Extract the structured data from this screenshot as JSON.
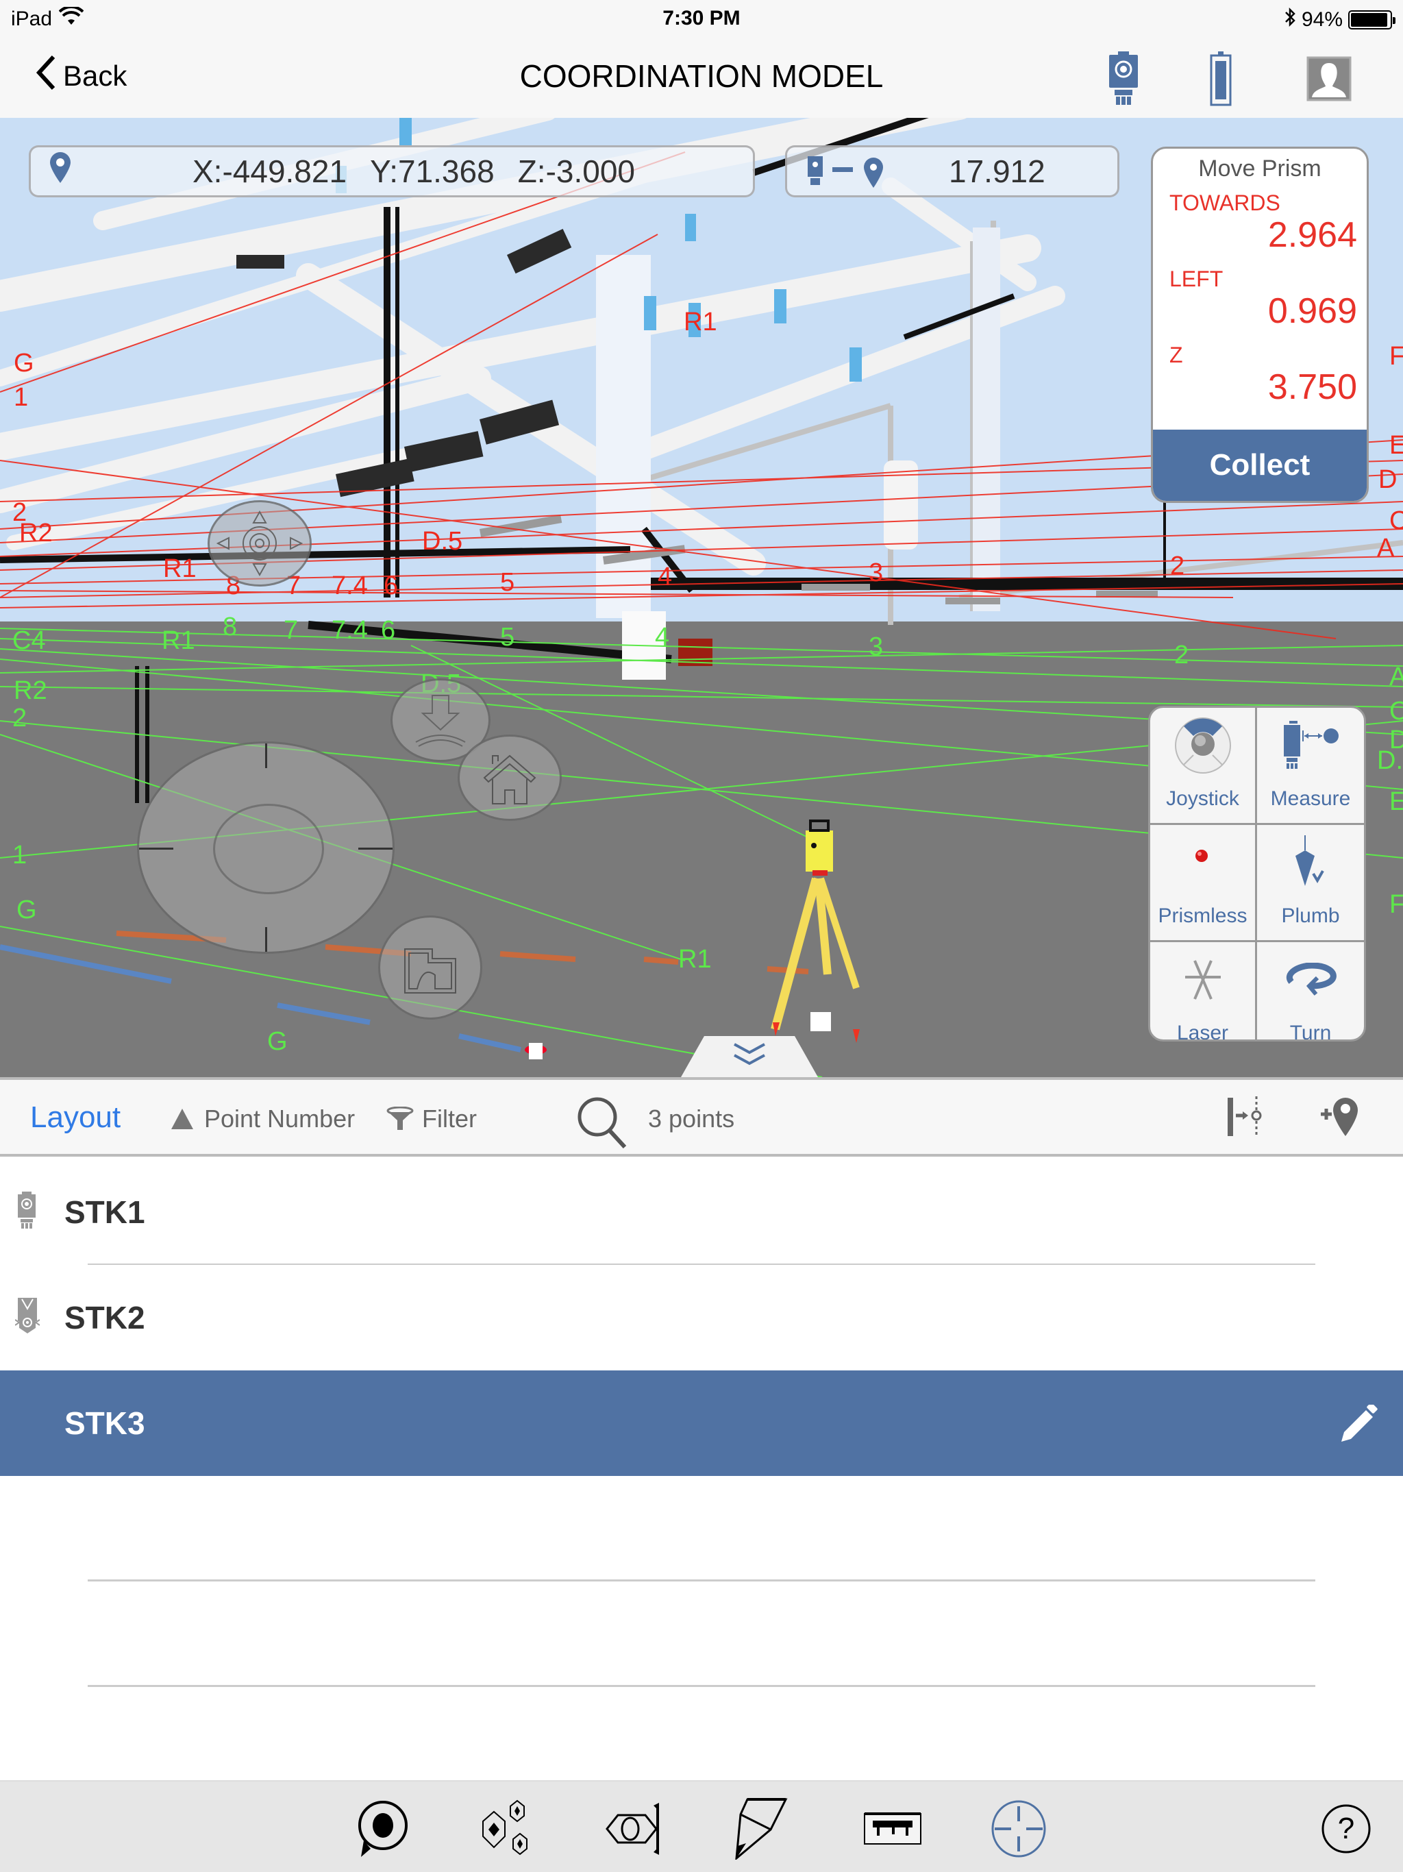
{
  "status_bar": {
    "device": "iPad",
    "time": "7:30 PM",
    "battery_percent": "94%",
    "battery_level": 0.94,
    "icons": [
      "wifi-icon",
      "bluetooth-icon",
      "battery-icon"
    ]
  },
  "nav": {
    "back_label": "Back",
    "title": "COORDINATION MODEL",
    "icons": [
      "instrument-icon",
      "prism-rod-icon",
      "profile-icon"
    ]
  },
  "viewport": {
    "coords": {
      "x": "X:-449.821",
      "y": "Y:71.368",
      "z": "Z:-3.000"
    },
    "distance": "17.912",
    "grid_labels_red": [
      "R1",
      "G",
      "1",
      "2",
      "R2",
      "R1",
      "D.5",
      "8",
      "7",
      "7.4",
      "6",
      "5",
      "4",
      "3",
      "2",
      "F",
      "E",
      "D",
      "C",
      "A"
    ],
    "grid_labels_green": [
      "R1",
      "R2",
      "2",
      "8",
      "7",
      "7.4",
      "6",
      "5",
      "D.5",
      "4",
      "3",
      "2",
      "1",
      "G",
      "G",
      "R1",
      "A",
      "C",
      "D",
      "D.",
      "E",
      "F"
    ],
    "collapse_icon": "double-chevron-down-icon"
  },
  "move_prism": {
    "title": "Move Prism",
    "towards_label": "TOWARDS",
    "towards_value": "2.964",
    "left_label": "LEFT",
    "left_value": "0.969",
    "z_label": "Z",
    "z_value": "3.750",
    "collect_label": "Collect"
  },
  "instrument_controls": [
    {
      "label": "Joystick",
      "icon": "joystick-icon"
    },
    {
      "label": "Measure",
      "icon": "measure-icon"
    },
    {
      "label": "Prismless",
      "icon": "prismless-icon"
    },
    {
      "label": "Plumb",
      "icon": "plumb-icon"
    },
    {
      "label": "Laser",
      "icon": "laser-icon"
    },
    {
      "label": "Turn",
      "icon": "turn-icon"
    }
  ],
  "list_toolbar": {
    "layout_label": "Layout",
    "sort_label": "Point Number",
    "filter_label": "Filter",
    "count_label": "3 points"
  },
  "points": [
    {
      "name": "STK1",
      "icon": "instrument-icon",
      "selected": false
    },
    {
      "name": "STK2",
      "icon": "prism-icon",
      "selected": false
    },
    {
      "name": "STK3",
      "icon": "",
      "selected": true
    }
  ],
  "bottom_toolbar": [
    {
      "icon": "point-icon",
      "active": false
    },
    {
      "icon": "model-objects-icon",
      "active": false
    },
    {
      "icon": "view-icon",
      "active": false
    },
    {
      "icon": "surface-icon",
      "active": false
    },
    {
      "icon": "measure-tape-icon",
      "active": false
    },
    {
      "icon": "stakeout-target-icon",
      "active": true
    },
    {
      "icon": "help-icon",
      "active": false
    }
  ],
  "colors": {
    "accent": "#4f72a3",
    "link_blue": "#2f7ae5",
    "alert_red": "#e8322a",
    "grid_red": "#ee2a1e",
    "grid_green": "#5de84a"
  }
}
